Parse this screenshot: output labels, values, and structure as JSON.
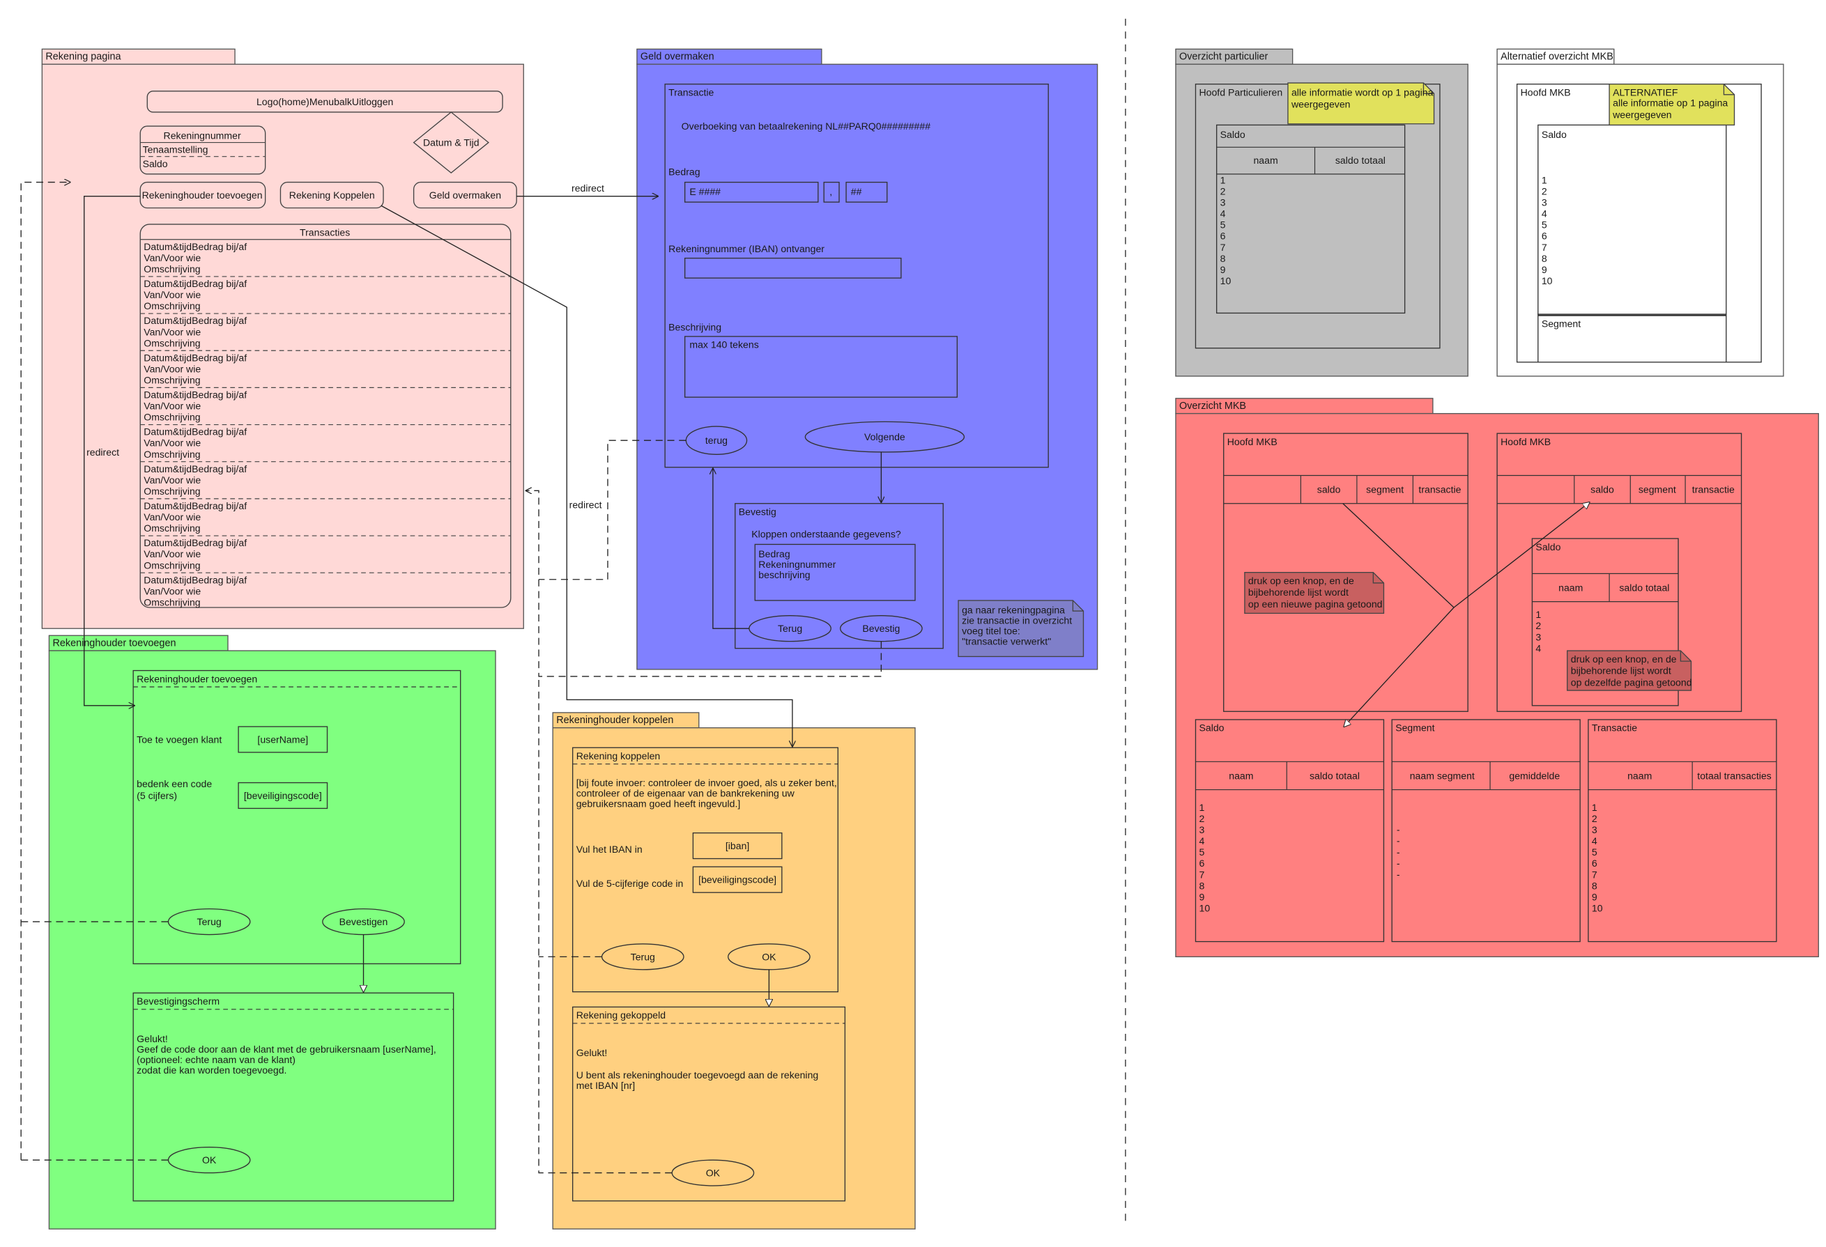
{
  "colors": {
    "rekening_bg": "#ffd9d7",
    "geld_bg": "#8080ff",
    "toevoegen_bg": "#80ff80",
    "koppelen_bg": "#ffd080",
    "particulier_bg": "#bfbfbf",
    "mkb_bg": "#ff8080",
    "note_yellow": "#e1e15c",
    "note_blue": "#7f7fc9",
    "note_red": "#c86060"
  },
  "rekening_pagina": {
    "tab": "Rekening pagina",
    "menubar": "Logo(home)MenubalkUitloggen",
    "account_title": "Rekeningnummer",
    "account_lines": [
      "Tenaamstelling",
      "Saldo"
    ],
    "datetime": "Datum & Tijd",
    "btn_toevoegen": "Rekeninghouder toevoegen",
    "btn_koppelen": "Rekening Koppelen",
    "btn_geld": "Geld overmaken",
    "transacties_title": "Transacties",
    "transaction_lines": [
      "Datum&tijdBedrag bij/af",
      "Van/Voor wie",
      "Omschrijving"
    ],
    "transaction_count": 10
  },
  "geld_overmaken": {
    "tab": "Geld overmaken",
    "inner_title": "Transactie",
    "overboeking": "Overboeking van betaalrekening NL##PARQ0#########",
    "bedrag_label": "Bedrag",
    "bedrag_value": "E ####",
    "comma": ",",
    "cents": "##",
    "iban_label": "Rekeningnummer (IBAN) ontvanger",
    "beschrijving_label": "Beschrijving",
    "beschrijving_placeholder": "max 140 tekens",
    "btn_terug": "terug",
    "btn_volgende": "Volgende",
    "bevestig_title": "Bevestig",
    "bevestig_question": "Kloppen onderstaande gegevens?",
    "bevestig_lines": [
      "Bedrag",
      "Rekeningnummer",
      "beschrijving"
    ],
    "bevestig_terug": "Terug",
    "bevestig_ok": "Bevestig",
    "note_lines": [
      "ga naar rekeningpagina",
      "zie transactie in overzicht",
      "voeg titel toe:",
      "\"transactie verwerkt\""
    ]
  },
  "connectors": {
    "redirect_1": "redirect",
    "redirect_2": "redirect",
    "redirect_3": "redirect"
  },
  "rekeninghouder_toevoegen": {
    "tab": "Rekeninghouder toevoegen",
    "inner_title": "Rekeninghouder toevoegen",
    "klant_label": "Toe te voegen klant",
    "klant_field": "[userName]",
    "code_label_lines": [
      "bedenk een code",
      "(5 cijfers)"
    ],
    "code_field": "[beveiligingscode]",
    "btn_terug": "Terug",
    "btn_bevestigen": "Bevestigen",
    "confirm_title": "Bevestigingscherm",
    "confirm_lines": [
      "Gelukt!",
      "Geef de code door aan de klant met de gebruikersnaam [userName],",
      "(optioneel: echte naam van de klant)",
      "zodat die kan worden toegevoegd."
    ],
    "btn_ok": "OK"
  },
  "rekeninghouder_koppelen": {
    "tab": "Rekeninghouder koppelen",
    "inner_title": "Rekening koppelen",
    "instruction_lines": [
      "[bij foute invoer: controleer de invoer goed, als u zeker bent,",
      "controleer of de eigenaar van de bankrekening uw",
      "gebruikersnaam goed heeft ingevuld.]"
    ],
    "iban_label": "Vul het IBAN in",
    "iban_field": "[iban]",
    "code_label": "Vul de 5-cijferige code in",
    "code_field": "[beveiligingscode]",
    "btn_terug": "Terug",
    "btn_ok": "OK",
    "done_title": "Rekening gekoppeld",
    "done_lines": [
      "Gelukt!",
      "",
      "U bent als rekeninghouder toegevoegd aan de rekening",
      "met IBAN [nr]"
    ],
    "btn_done_ok": "OK"
  },
  "overzicht_particulier": {
    "tab": "Overzicht particulier",
    "hoofd": "Hoofd Particulieren",
    "note_lines": [
      "alle informatie wordt op 1 pagina",
      "weergegeven"
    ],
    "saldo_title": "Saldo",
    "col_naam": "naam",
    "col_saldo": "saldo totaal",
    "rows": [
      "1",
      "2",
      "3",
      "4",
      "5",
      "6",
      "7",
      "8",
      "9",
      "10"
    ]
  },
  "alternatief_mkb": {
    "tab": "Alternatief overzicht MKB",
    "hoofd": "Hoofd MKB",
    "note_lines": [
      "ALTERNATIEF",
      "alle informatie op 1 pagina",
      "weergegeven"
    ],
    "saldo_title": "Saldo",
    "rows": [
      "1",
      "2",
      "3",
      "4",
      "5",
      "6",
      "7",
      "8",
      "9",
      "10"
    ],
    "segment_title": "Segment"
  },
  "overzicht_mkb": {
    "tab": "Overzicht MKB",
    "hoofd_left": "Hoofd MKB",
    "hoofd_right": "Hoofd MKB",
    "tab_saldo": "saldo",
    "tab_segment": "segment",
    "tab_transactie": "transactie",
    "note_left_lines": [
      "druk op een knop, en de",
      "bijbehorende lijst wordt",
      "op een nieuwe pagina getoond"
    ],
    "note_right_lines": [
      "druk op een knop, en de",
      "bijbehorende lijst wordt",
      "op dezelfde pagina getoond"
    ],
    "inner_saldo_title": "Saldo",
    "inner_col_naam": "naam",
    "inner_col_saldo": "saldo totaal",
    "inner_rows": [
      "1",
      "2",
      "3",
      "4"
    ],
    "saldo_box_title": "Saldo",
    "saldo_col_naam": "naam",
    "saldo_col_totaal": "saldo totaal",
    "saldo_rows": [
      "1",
      "2",
      "3",
      "4",
      "5",
      "6",
      "7",
      "8",
      "9",
      "10"
    ],
    "segment_box_title": "Segment",
    "segment_col_naam": "naam segment",
    "segment_col_gem": "gemiddelde",
    "segment_rows": [
      "-",
      "-",
      "-",
      "-",
      "-"
    ],
    "transactie_box_title": "Transactie",
    "transactie_col_naam": "naam",
    "transactie_col_totaal": "totaal transacties",
    "transactie_rows": [
      "1",
      "2",
      "3",
      "4",
      "5",
      "6",
      "7",
      "8",
      "9",
      "10"
    ]
  }
}
